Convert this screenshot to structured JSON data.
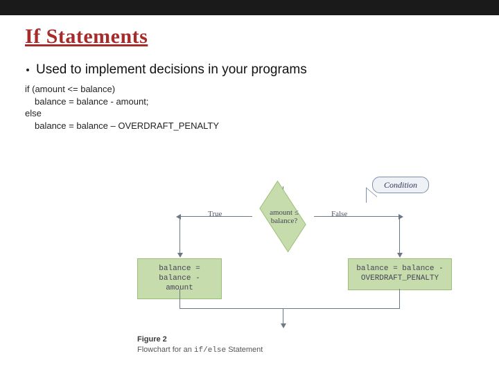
{
  "title": "If Statements",
  "bullet": "Used to implement decisions in your programs",
  "code": {
    "l1": "if (amount <= balance)",
    "l2": "balance = balance - amount;",
    "l3": "else",
    "l4": "balance = balance – OVERDRAFT_PENALTY"
  },
  "flow": {
    "callout": "Condition",
    "diamond_line1": "amount ≤",
    "diamond_line2": "balance?",
    "true_label": "True",
    "false_label": "False",
    "left_box_l1": "balance =",
    "left_box_l2": "balance - amount",
    "right_box_l1": "balance = balance -",
    "right_box_l2": "OVERDRAFT_PENALTY",
    "caption_fig": "Figure 2",
    "caption_pre": "Flowchart for an ",
    "caption_mono": "if/else",
    "caption_post": " Statement"
  }
}
